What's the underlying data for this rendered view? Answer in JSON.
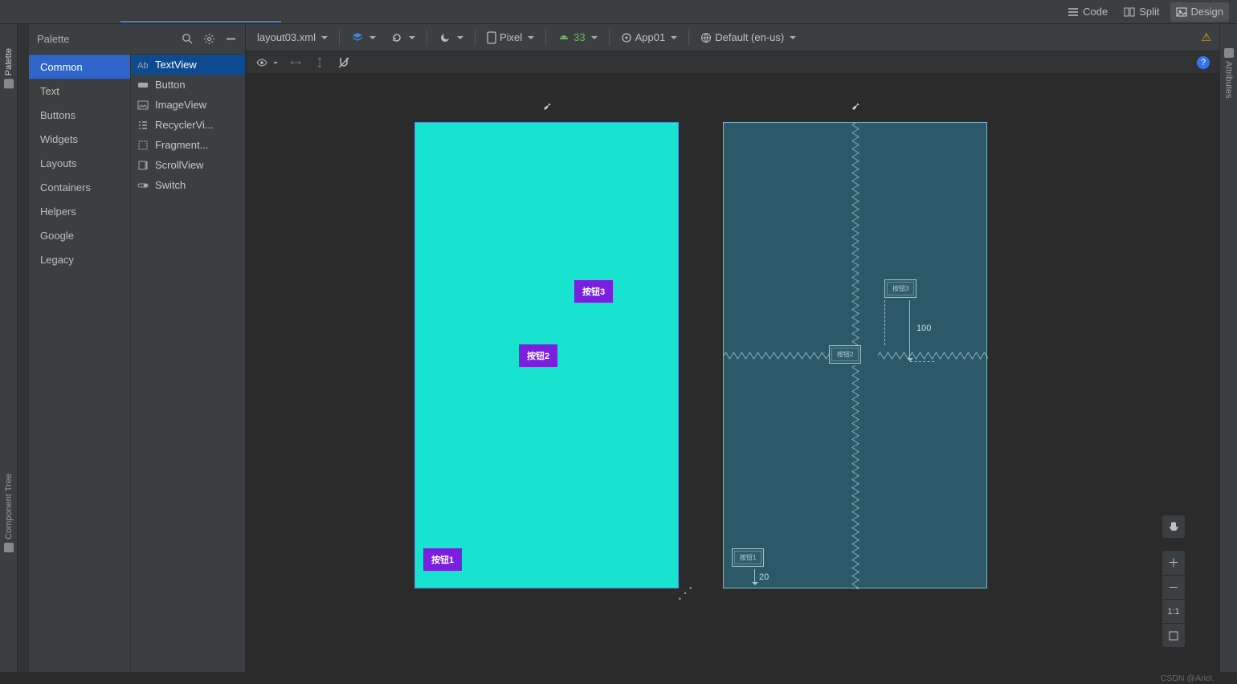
{
  "views": {
    "code": "Code",
    "split": "Split",
    "design": "Design"
  },
  "palette": {
    "title": "Palette",
    "categories": [
      "Common",
      "Text",
      "Buttons",
      "Widgets",
      "Layouts",
      "Containers",
      "Helpers",
      "Google",
      "Legacy"
    ],
    "selected_category_index": 0,
    "items": [
      "TextView",
      "Button",
      "ImageView",
      "RecyclerVi...",
      "Fragment...",
      "ScrollView",
      "Switch"
    ],
    "selected_item_index": 0
  },
  "toolbar": {
    "file": "layout03.xml",
    "device": "Pixel",
    "api_prefix": "",
    "api_num": "33",
    "app": "App01",
    "locale": "Default (en-us)"
  },
  "designer": {
    "btn1": "按钮1",
    "btn2": "按钮2",
    "btn3": "按钮3",
    "bp_btn1": "按钮1",
    "bp_btn2": "按钮2",
    "bp_btn3": "按钮3",
    "margin_100": "100",
    "margin_20": "20"
  },
  "zoom": {
    "ratio": "1:1"
  },
  "rails": {
    "palette": "Palette",
    "component_tree": "Component Tree",
    "attributes": "Attributes"
  },
  "footer": {
    "watermark": "CSDN @AricI."
  }
}
